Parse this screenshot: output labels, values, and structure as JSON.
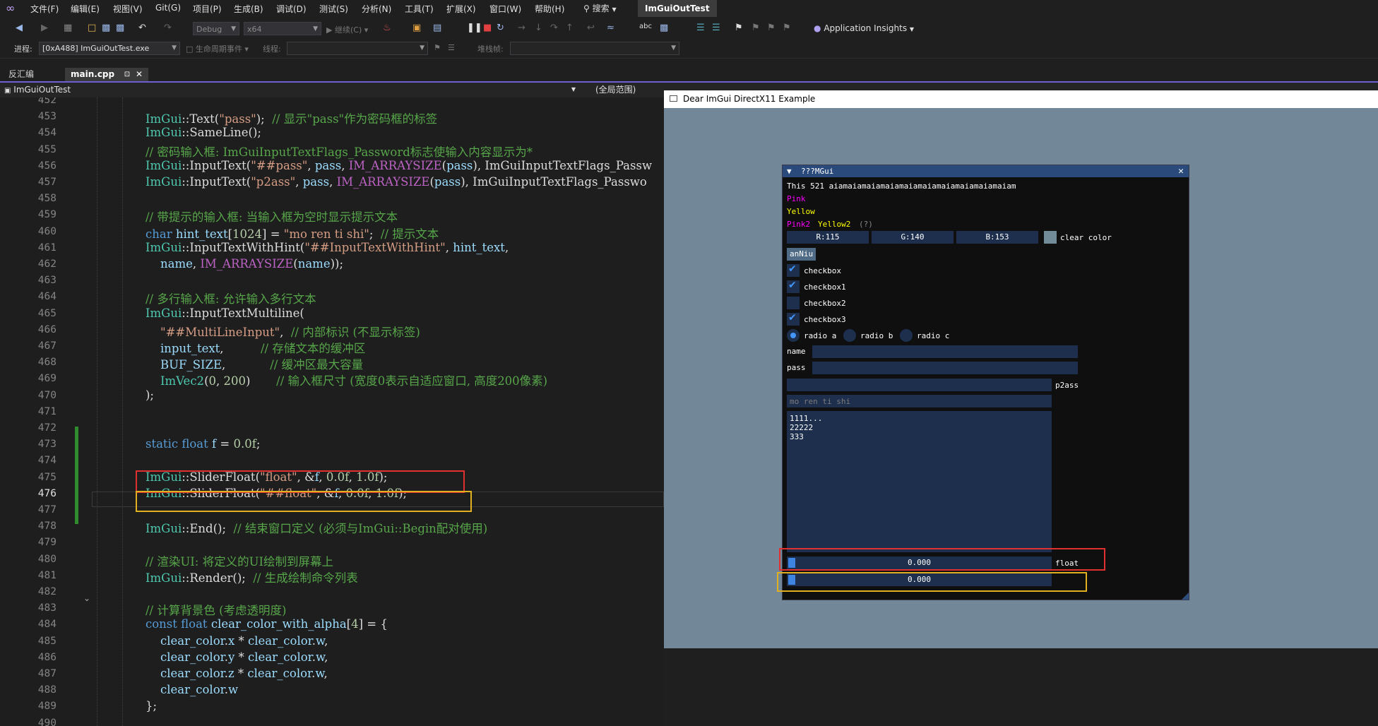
{
  "menubar": {
    "items": [
      "文件(F)",
      "编辑(E)",
      "视图(V)",
      "Git(G)",
      "项目(P)",
      "生成(B)",
      "调试(D)",
      "测试(S)",
      "分析(N)",
      "工具(T)",
      "扩展(X)",
      "窗口(W)",
      "帮助(H)"
    ],
    "search_label": "搜索",
    "solution_title": "ImGuiOutTest"
  },
  "toolbar": {
    "config": "Debug",
    "platform": "x64",
    "continue_label": "继续(C)",
    "app_insights": "Application Insights"
  },
  "debugbar": {
    "process_label": "进程:",
    "process_value": "[0xA488] ImGuiOutTest.exe",
    "lifecycle_label": "生命周期事件",
    "thread_label": "线程:",
    "stack_label": "堆栈帧:"
  },
  "tabs": [
    {
      "label": "反汇编"
    },
    {
      "label": "main.cpp"
    }
  ],
  "navbar": {
    "scope": "ImGuiOutTest",
    "global": "(全局范围)"
  },
  "editor": {
    "current_line": 476,
    "line_numbers": [
      "452",
      "453",
      "454",
      "455",
      "456",
      "457",
      "458",
      "459",
      "460",
      "461",
      "462",
      "463",
      "464",
      "465",
      "466",
      "467",
      "468",
      "469",
      "470",
      "471",
      "472",
      "473",
      "474",
      "475",
      "476",
      "477",
      "478",
      "479",
      "480",
      "481",
      "482",
      "483",
      "484",
      "485",
      "486",
      "487",
      "488",
      "489",
      "490"
    ],
    "lines": [
      "",
      "ImGui::Text(\"pass\");  // 显示\"pass\"作为密码框的标签",
      "ImGui::SameLine();",
      "// 密码输入框: ImGuiInputTextFlags_Password标志使输入内容显示为*",
      "ImGui::InputText(\"##pass\", pass, IM_ARRAYSIZE(pass), ImGuiInputTextFlags_Passw",
      "ImGui::InputText(\"p2ass\", pass, IM_ARRAYSIZE(pass), ImGuiInputTextFlags_Passwo",
      "",
      "// 带提示的输入框: 当输入框为空时显示提示文本",
      "char hint_text[1024] = \"mo ren ti shi\";  // 提示文本",
      "ImGui::InputTextWithHint(\"##InputTextWithHint\", hint_text,",
      "    name, IM_ARRAYSIZE(name));",
      "",
      "// 多行输入框: 允许输入多行文本",
      "ImGui::InputTextMultiline(",
      "    \"##MultiLineInput\",  // 内部标识 (不显示标签)",
      "    input_text,          // 存储文本的缓冲区",
      "    BUF_SIZE,            // 缓冲区最大容量",
      "    ImVec2(0, 200)       // 输入框尺寸 (宽度0表示自适应窗口, 高度200像素)",
      ");",
      "",
      "",
      "static float f = 0.0f;",
      "",
      "ImGui::SliderFloat(\"float\", &f, 0.0f, 1.0f);",
      "ImGui::SliderFloat(\"##float\", &f, 0.0f, 1.0f);",
      "",
      "ImGui::End();  // 结束窗口定义 (必须与ImGui::Begin配对使用)",
      "",
      "// 渲染UI: 将定义的UI绘制到屏幕上",
      "ImGui::Render();  // 生成绘制命令列表",
      "",
      "// 计算背景色 (考虑透明度)",
      "const float clear_color_with_alpha[4] = {",
      "    clear_color.x * clear_color.w,",
      "    clear_color.y * clear_color.w,",
      "    clear_color.z * clear_color.w,",
      "    clear_color.w",
      "};",
      ""
    ]
  },
  "host_window": {
    "title": "Dear ImGui DirectX11 Example"
  },
  "imgui": {
    "title": "???MGui",
    "text_line": "This 521 aiamaiamaiamaiamaiamaiamaiamaiamaiamaiam",
    "pink": "Pink",
    "yellow": "Yellow",
    "pink2": "Pink2",
    "yellow2": "Yellow2",
    "help_mark": "(?)",
    "r": "R:115",
    "g": "G:140",
    "b": "B:153",
    "clear_color_label": "clear color",
    "clear_color_hex": "#738c99",
    "button_label": "anNiu",
    "checkboxes": [
      {
        "label": "checkbox",
        "checked": true
      },
      {
        "label": "checkbox1",
        "checked": true
      },
      {
        "label": "checkbox2",
        "checked": false
      },
      {
        "label": "checkbox3",
        "checked": true
      }
    ],
    "radios": [
      {
        "label": "radio a",
        "selected": true
      },
      {
        "label": "radio b",
        "selected": false
      },
      {
        "label": "radio c",
        "selected": false
      }
    ],
    "name_label": "name",
    "pass_label": "pass",
    "p2ass_label": "p2ass",
    "hint_placeholder": "mo ren ti shi",
    "multiline": "1111...\n22222\n333",
    "slider1_value": "0.000",
    "slider1_label": "float",
    "slider2_value": "0.000"
  },
  "colors": {
    "accent": "#4296fa",
    "highlight_red": "#e03030",
    "highlight_yellow": "#e0b020"
  }
}
